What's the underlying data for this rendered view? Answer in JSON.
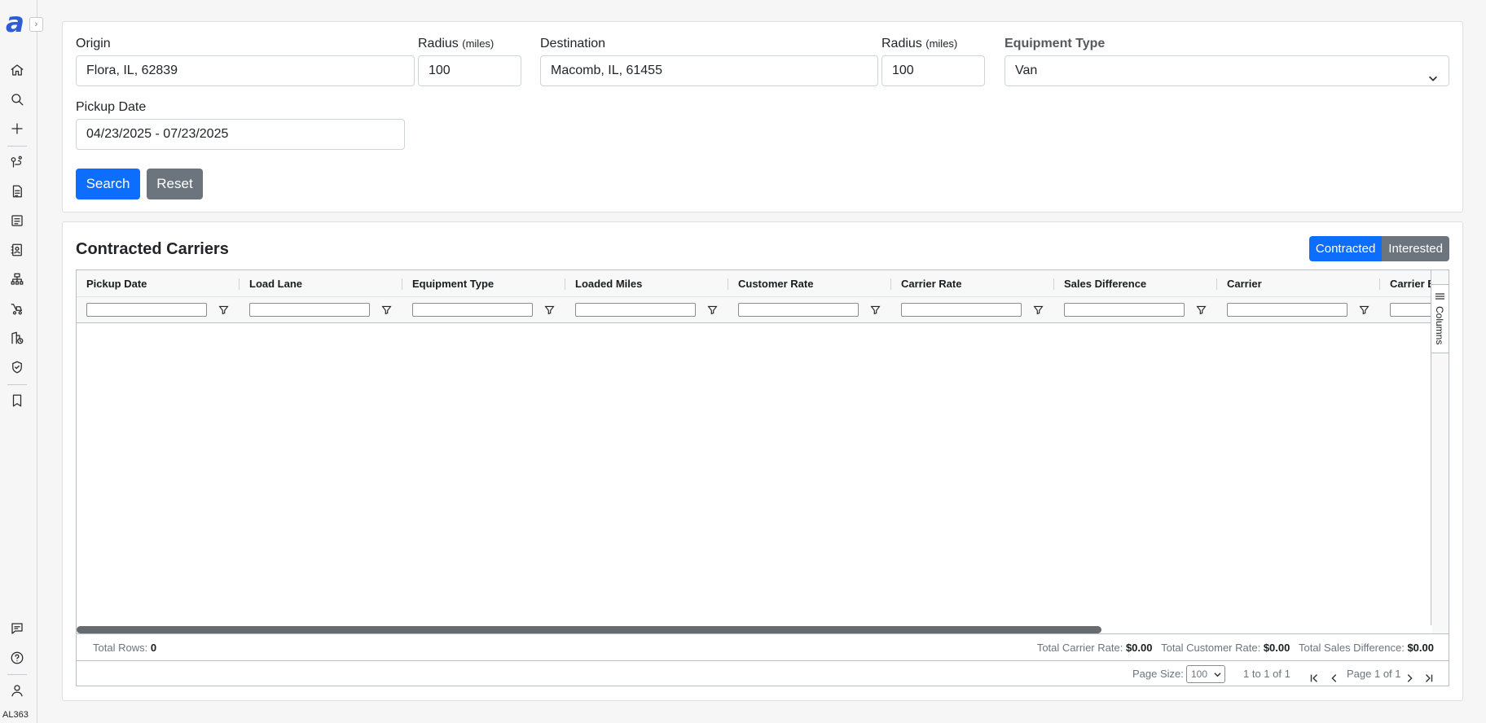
{
  "sidebar": {
    "logo": "a",
    "expand": "›",
    "icons": [
      "home-icon",
      "search-icon",
      "plus-icon",
      "route-icon",
      "document-icon",
      "list-document-icon",
      "contacts-book-icon",
      "org-chart-icon",
      "truck-icon",
      "building-clock-icon",
      "shield-check-icon",
      "bookmark-icon",
      "chat-icon",
      "help-icon",
      "user-icon"
    ],
    "user_id": "AL363"
  },
  "search": {
    "origin_label": "Origin",
    "origin_value": "Flora, IL, 62839",
    "radius_label": "Radius",
    "radius_unit": "(miles)",
    "origin_radius_value": "100",
    "destination_label": "Destination",
    "destination_value": "Macomb, IL, 61455",
    "destination_radius_value": "100",
    "equipment_label": "Equipment Type",
    "equipment_value": "Van",
    "pickup_label": "Pickup Date",
    "pickup_value": "04/23/2025 - 07/23/2025",
    "search_button": "Search",
    "reset_button": "Reset"
  },
  "results": {
    "title": "Contracted Carriers",
    "toggle_contracted": "Contracted",
    "toggle_interested": "Interested",
    "columns": [
      "Pickup Date",
      "Load Lane",
      "Equipment Type",
      "Loaded Miles",
      "Customer Rate",
      "Carrier Rate",
      "Sales Difference",
      "Carrier",
      "Carrier E"
    ],
    "side_panel_label": "Columns",
    "status": {
      "total_rows_label": "Total Rows:",
      "total_rows_value": "0",
      "total_carrier_rate_label": "Total Carrier Rate:",
      "total_carrier_rate_value": "$0.00",
      "total_customer_rate_label": "Total Customer Rate:",
      "total_customer_rate_value": "$0.00",
      "total_sales_diff_label": "Total Sales Difference:",
      "total_sales_diff_value": "$0.00"
    },
    "paging": {
      "page_size_label": "Page Size:",
      "page_size_value": "100",
      "row_summary": "1 to 1 of 1",
      "page_text": "Page 1 of 1"
    }
  }
}
